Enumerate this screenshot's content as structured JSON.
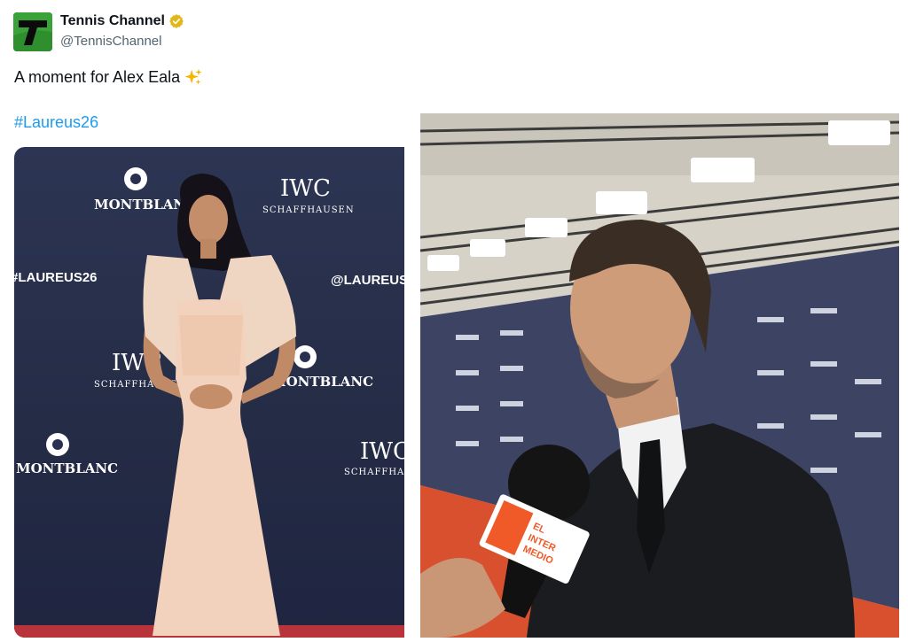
{
  "author": {
    "display_name": "Tennis Channel",
    "handle": "@TennisChannel",
    "verified_icon": "verified-gold-badge-icon",
    "avatar_icon": "tennis-channel-logo-icon",
    "avatar_color": "#2e8b2e"
  },
  "tweet": {
    "text": "A moment for Alex Eala",
    "emoji_icon": "sparkles-icon",
    "hashtag": "#Laureus26",
    "hashtag_color": "#1d9bf0"
  },
  "media": {
    "left_photo": {
      "backdrop_brands": [
        "MONTBLANC",
        "IWC",
        "SCHAFFHAUSEN",
        "#LAUREUS26",
        "@LAUREUS"
      ],
      "backdrop_color": "#29304c"
    },
    "right_photo": {
      "mic_brand_lines": [
        "EL",
        "INTER",
        "MEDIO"
      ],
      "mic_flag_color": "#f05a28"
    }
  }
}
